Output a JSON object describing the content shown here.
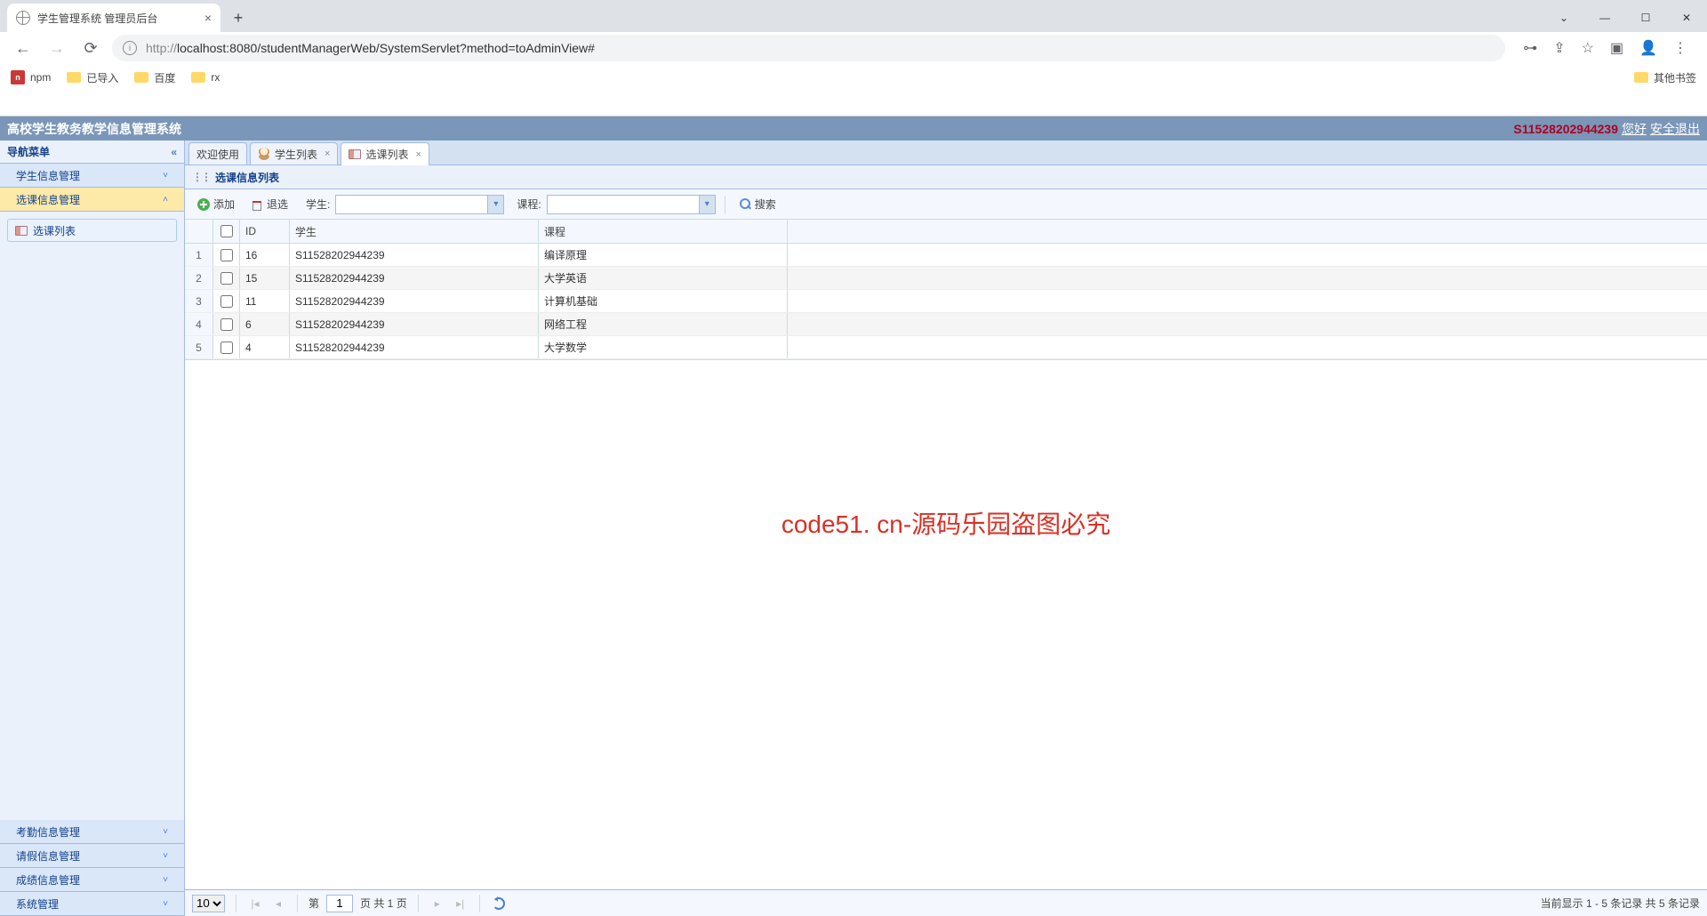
{
  "browser": {
    "tab_title": "学生管理系统 管理员后台",
    "url_prefix": "http://",
    "url_rest": "localhost:8080/studentManagerWeb/SystemServlet?method=toAdminView#",
    "bookmarks": {
      "npm": "npm",
      "imported": "已导入",
      "baidu": "百度",
      "rx": "rx",
      "other": "其他书签"
    }
  },
  "header": {
    "title": "高校学生教务教学信息管理系统",
    "user_id": "S11528202944239",
    "greeting": "您好",
    "logout": "安全退出"
  },
  "sidebar": {
    "nav_title": "导航菜单",
    "menus": {
      "student_info": "学生信息管理",
      "course_select": "选课信息管理",
      "attendance": "考勤信息管理",
      "leave": "请假信息管理",
      "score": "成绩信息管理",
      "system": "系统管理"
    },
    "tree_item": "选课列表"
  },
  "tabs": {
    "welcome": "欢迎使用",
    "student_list": "学生列表",
    "course_list": "选课列表"
  },
  "panel": {
    "title": "选课信息列表"
  },
  "toolbar": {
    "add": "添加",
    "remove": "退选",
    "student_label": "学生:",
    "course_label": "课程:",
    "search": "搜索"
  },
  "grid": {
    "headers": {
      "id": "ID",
      "student": "学生",
      "course": "课程"
    },
    "rows": [
      {
        "n": "1",
        "id": "16",
        "student": "S11528202944239",
        "course": "编译原理"
      },
      {
        "n": "2",
        "id": "15",
        "student": "S11528202944239",
        "course": "大学英语"
      },
      {
        "n": "3",
        "id": "11",
        "student": "S11528202944239",
        "course": "计算机基础"
      },
      {
        "n": "4",
        "id": "6",
        "student": "S11528202944239",
        "course": "网络工程"
      },
      {
        "n": "5",
        "id": "4",
        "student": "S11528202944239",
        "course": "大学数学"
      }
    ]
  },
  "watermark": "code51. cn-源码乐园盗图必究",
  "pager": {
    "page_size": "10",
    "page_prefix": "第",
    "page_value": "1",
    "page_suffix": "页 共 1 页",
    "info": "当前显示 1 - 5 条记录 共 5 条记录"
  }
}
